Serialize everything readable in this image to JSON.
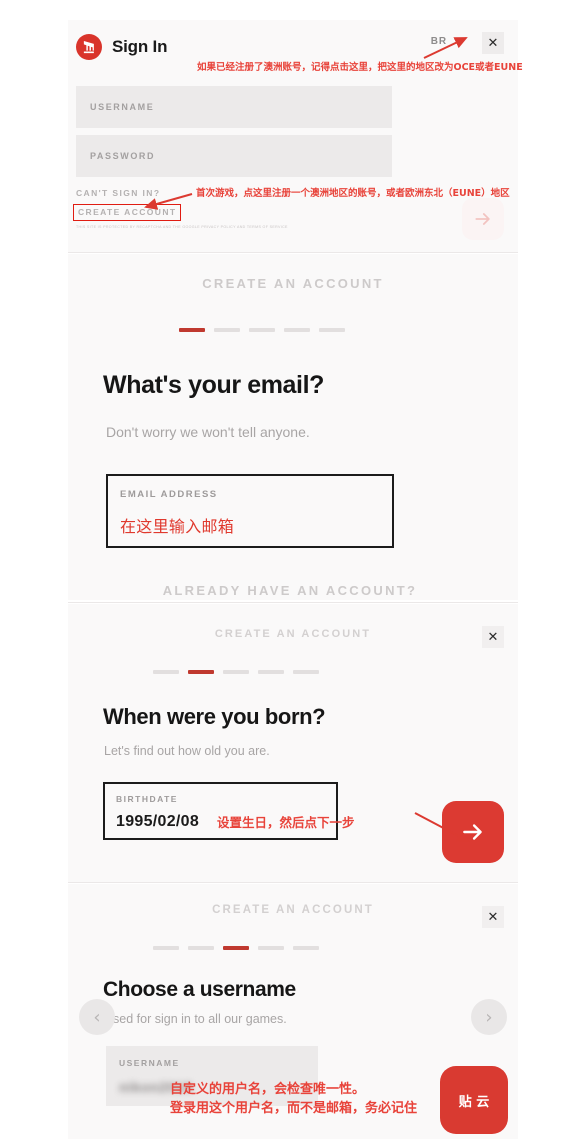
{
  "signin": {
    "title": "Sign In",
    "logo_icon": "riot-fist-icon",
    "region_code": "BR",
    "region_chevron_icon": "chevron-down-icon",
    "close_icon": "close-icon",
    "username_label": "USERNAME",
    "password_label": "PASSWORD",
    "cant_sign_in": "CAN'T SIGN IN?",
    "create_account": "CREATE ACCOUNT",
    "legal": "THIS SITE IS PROTECTED BY RECAPTCHA AND THE GOOGLE PRIVACY POLICY AND TERMS OF SERVICE",
    "legal_link_1": "PRIVACY POLICY",
    "legal_link_2": "TERMS OF SERVICE",
    "submit_icon": "arrow-right-icon"
  },
  "email_step": {
    "heading": "CREATE AN ACCOUNT",
    "steps_total": 5,
    "active_step": 1,
    "question": "What's your email?",
    "subtitle": "Don't worry we won't tell anyone.",
    "field_label": "EMAIL ADDRESS",
    "field_value": "在这里输入邮箱",
    "already_have_account": "ALREADY HAVE AN ACCOUNT?"
  },
  "birth_step": {
    "heading": "CREATE AN ACCOUNT",
    "steps_total": 5,
    "active_step": 2,
    "question": "When were you born?",
    "subtitle": "Let's find out how old you are.",
    "field_label": "BIRTHDATE",
    "field_value": "1995/02/08",
    "close_icon": "close-icon",
    "next_icon": "arrow-right-icon"
  },
  "username_step": {
    "heading": "CREATE AN ACCOUNT",
    "steps_total": 5,
    "active_step": 3,
    "question": "Choose a username",
    "subtitle": "Used for sign in to all our games.",
    "field_label": "USERNAME",
    "field_value": "nikon2018",
    "close_icon": "close-icon",
    "prev_icon": "chevron-left-icon",
    "next_icon": "chevron-right-icon",
    "watermark_text": "贴 云"
  },
  "annotations": {
    "region": "如果已经注册了澳洲账号，记得点击这里，把这里的地区改为OCE或者EUNE",
    "create_account": "首次游戏，点这里注册一个澳洲地区的账号，或者欧洲东北（EUNE）地区",
    "email": "在这里输入邮箱",
    "birthdate": "设置生日，然后点下一步",
    "username_line1": "自定义的用户名，会检查唯一性。",
    "username_line2": "登录用这个用户名，而不是邮箱，务必记住"
  },
  "colors": {
    "brand_red": "#d9342b",
    "annotation_red": "#e8433a",
    "panel_bg": "#faf9f9",
    "field_bg": "#eceaea"
  }
}
